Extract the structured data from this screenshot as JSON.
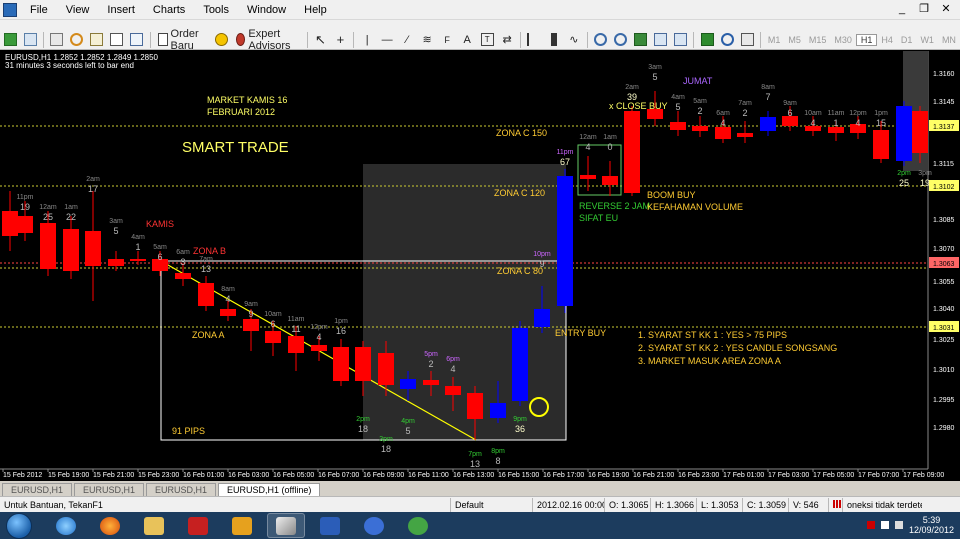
{
  "menu": {
    "items": [
      "File",
      "View",
      "Insert",
      "Charts",
      "Tools",
      "Window",
      "Help"
    ]
  },
  "toolbar": {
    "order_label": "Order Baru",
    "ea_label": "Expert Advisors",
    "timeframes": [
      "M1",
      "M5",
      "M15",
      "M30",
      "H1",
      "H4",
      "D1",
      "W1",
      "MN"
    ]
  },
  "chart": {
    "symbol_line": "EURUSD,H1  1.2852 1.2852 1.2849 1.2850",
    "timer_line": "31 minutes 3 seconds left to bar end",
    "title1": "MARKET KAMIS 16",
    "title2": "FEBRUARI 2012",
    "smart_trade": "SMART TRADE",
    "kamis": "KAMIS",
    "jumat": "JUMAT",
    "zona_b": "ZONA B",
    "zona_a": "ZONA A",
    "zona_c150": "ZONA C 150",
    "zona_c120": "ZONA C 120",
    "zona_c80": "ZONA C 80",
    "pips": "91 PIPS",
    "entry_buy": "ENTRY BUY",
    "reverse1": "REVERSE 2 JAM",
    "reverse2": "SIFAT EU",
    "close_buy": "x CLOSE BUY",
    "boom1": "BOOM BUY",
    "boom2": "KEFAHAMAN VOLUME",
    "rule1": "1.  SYARAT ST KK 1 :     YES  > 75 PIPS",
    "rule2": "2.  SYARAT ST KK 2 :      YES CANDLE SONGSANG",
    "rule3": "3.  MARKET MASUK AREA ZONA A",
    "price_labels": [
      "1.3160",
      "1.3145",
      "1.3137",
      "1.3115",
      "1.3102",
      "1.3085",
      "1.3070",
      "1.3063",
      "1.3055",
      "1.3040",
      "1.3031",
      "1.3025",
      "1.3010",
      "1.2995",
      "1.2980"
    ],
    "time_labels": [
      "15 Feb 2012",
      "15 Feb 19:00",
      "15 Feb 21:00",
      "15 Feb 23:00",
      "16 Feb 01:00",
      "16 Feb 03:00",
      "16 Feb 05:00",
      "16 Feb 07:00",
      "16 Feb 09:00",
      "16 Feb 11:00",
      "16 Feb 13:00",
      "16 Feb 15:00",
      "16 Feb 17:00",
      "16 Feb 19:00",
      "16 Feb 21:00",
      "16 Feb 23:00",
      "17 Feb 01:00",
      "17 Feb 03:00",
      "17 Feb 05:00",
      "17 Feb 07:00",
      "17 Feb 09:00"
    ],
    "candle_annotations": [
      {
        "t": "11pm",
        "n": "19"
      },
      {
        "t": "12am",
        "n": "25"
      },
      {
        "t": "1am",
        "n": "22"
      },
      {
        "t": "2am",
        "n": "17"
      },
      {
        "t": "3am",
        "n": "5"
      },
      {
        "t": "4am",
        "n": "1"
      },
      {
        "t": "5am",
        "n": "6"
      },
      {
        "t": "6am",
        "n": "3"
      },
      {
        "t": "7am",
        "n": "13"
      },
      {
        "t": "8am",
        "n": "4"
      },
      {
        "t": "9am",
        "n": "9"
      },
      {
        "t": "10am",
        "n": "6"
      },
      {
        "t": "11am",
        "n": "11"
      },
      {
        "t": "12pm",
        "n": "4"
      },
      {
        "t": "1pm",
        "n": "16"
      },
      {
        "t": "2pm",
        "n": "18"
      },
      {
        "t": "3pm",
        "n": "18"
      },
      {
        "t": "4pm",
        "n": "5"
      },
      {
        "t": "5pm",
        "n": "2"
      },
      {
        "t": "6pm",
        "n": "4"
      },
      {
        "t": "7pm",
        "n": "13"
      },
      {
        "t": "8pm",
        "n": "8"
      },
      {
        "t": "9pm",
        "n": "36"
      },
      {
        "t": "10pm",
        "n": "9"
      },
      {
        "t": "11pm",
        "n": "67"
      },
      {
        "t": "12am",
        "n": "4"
      },
      {
        "t": "1am",
        "n": "0"
      },
      {
        "t": "2am",
        "n": "39"
      },
      {
        "t": "3am",
        "n": "5"
      },
      {
        "t": "4am",
        "n": "5"
      },
      {
        "t": "5am",
        "n": "2"
      },
      {
        "t": "6am",
        "n": "4"
      },
      {
        "t": "7am",
        "n": "2"
      },
      {
        "t": "8am",
        "n": "7"
      },
      {
        "t": "9am",
        "n": "6"
      },
      {
        "t": "10am",
        "n": "4"
      },
      {
        "t": "11am",
        "n": "1"
      },
      {
        "t": "12pm",
        "n": "4"
      },
      {
        "t": "1pm",
        "n": "15"
      },
      {
        "t": "2pm",
        "n": "25"
      },
      {
        "t": "3pm",
        "n": "19"
      }
    ],
    "colors": {
      "bull": "#0000ff",
      "bear": "#ff0000",
      "title": "#ffff66",
      "zona": "#ffcc33",
      "green": "#33cc33",
      "purple": "#cc66ff",
      "highlight_box": "#2a2a2a"
    }
  },
  "tabs": [
    "EURUSD,H1",
    "EURUSD,H1",
    "EURUSD,H1",
    "EURUSD,H1 (offline)"
  ],
  "status": {
    "help": "Untuk Bantuan, TekanF1",
    "profile": "Default",
    "datetime": "2012.02.16 00:00",
    "open": "O: 1.3065",
    "high": "H: 1.3066",
    "low": "L: 1.3053",
    "close": "C: 1.3059",
    "volume": "V: 546",
    "connection": "oneksi tidak terdetek"
  },
  "clock": {
    "time": "5:39",
    "date": "12/09/2012"
  }
}
